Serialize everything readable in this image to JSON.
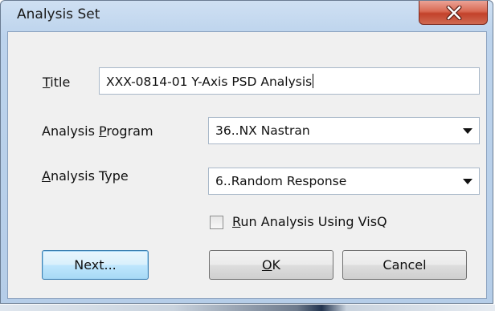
{
  "window": {
    "title": "Analysis Set",
    "close_glyph": "X"
  },
  "form": {
    "title_label": "Title",
    "title_mnemonic": "T",
    "title_label_rest": "itle",
    "title_value": "XXX-0814-01 Y-Axis PSD Analysis",
    "program_label_pre": "Analysis ",
    "program_label_mnemonic": "P",
    "program_label_post": "rogram",
    "program_value": "36..NX Nastran",
    "type_label_mnemonic": "A",
    "type_label_post": "nalysis Type",
    "type_value": "6..Random Response",
    "visq_mnemonic": "R",
    "visq_label_post": "un Analysis Using VisQ",
    "visq_checked": false
  },
  "buttons": {
    "next_label": "Next...",
    "ok_mnemonic": "O",
    "ok_label_post": "K",
    "cancel_label": "Cancel"
  },
  "icons": {
    "close": "close-icon",
    "dropdown": "chevron-down-icon"
  },
  "colors": {
    "titlebar": "#b5cde8",
    "close_button": "#c2412a",
    "client_bg": "#f0f0f0",
    "default_button_border": "#3c7fb1"
  }
}
